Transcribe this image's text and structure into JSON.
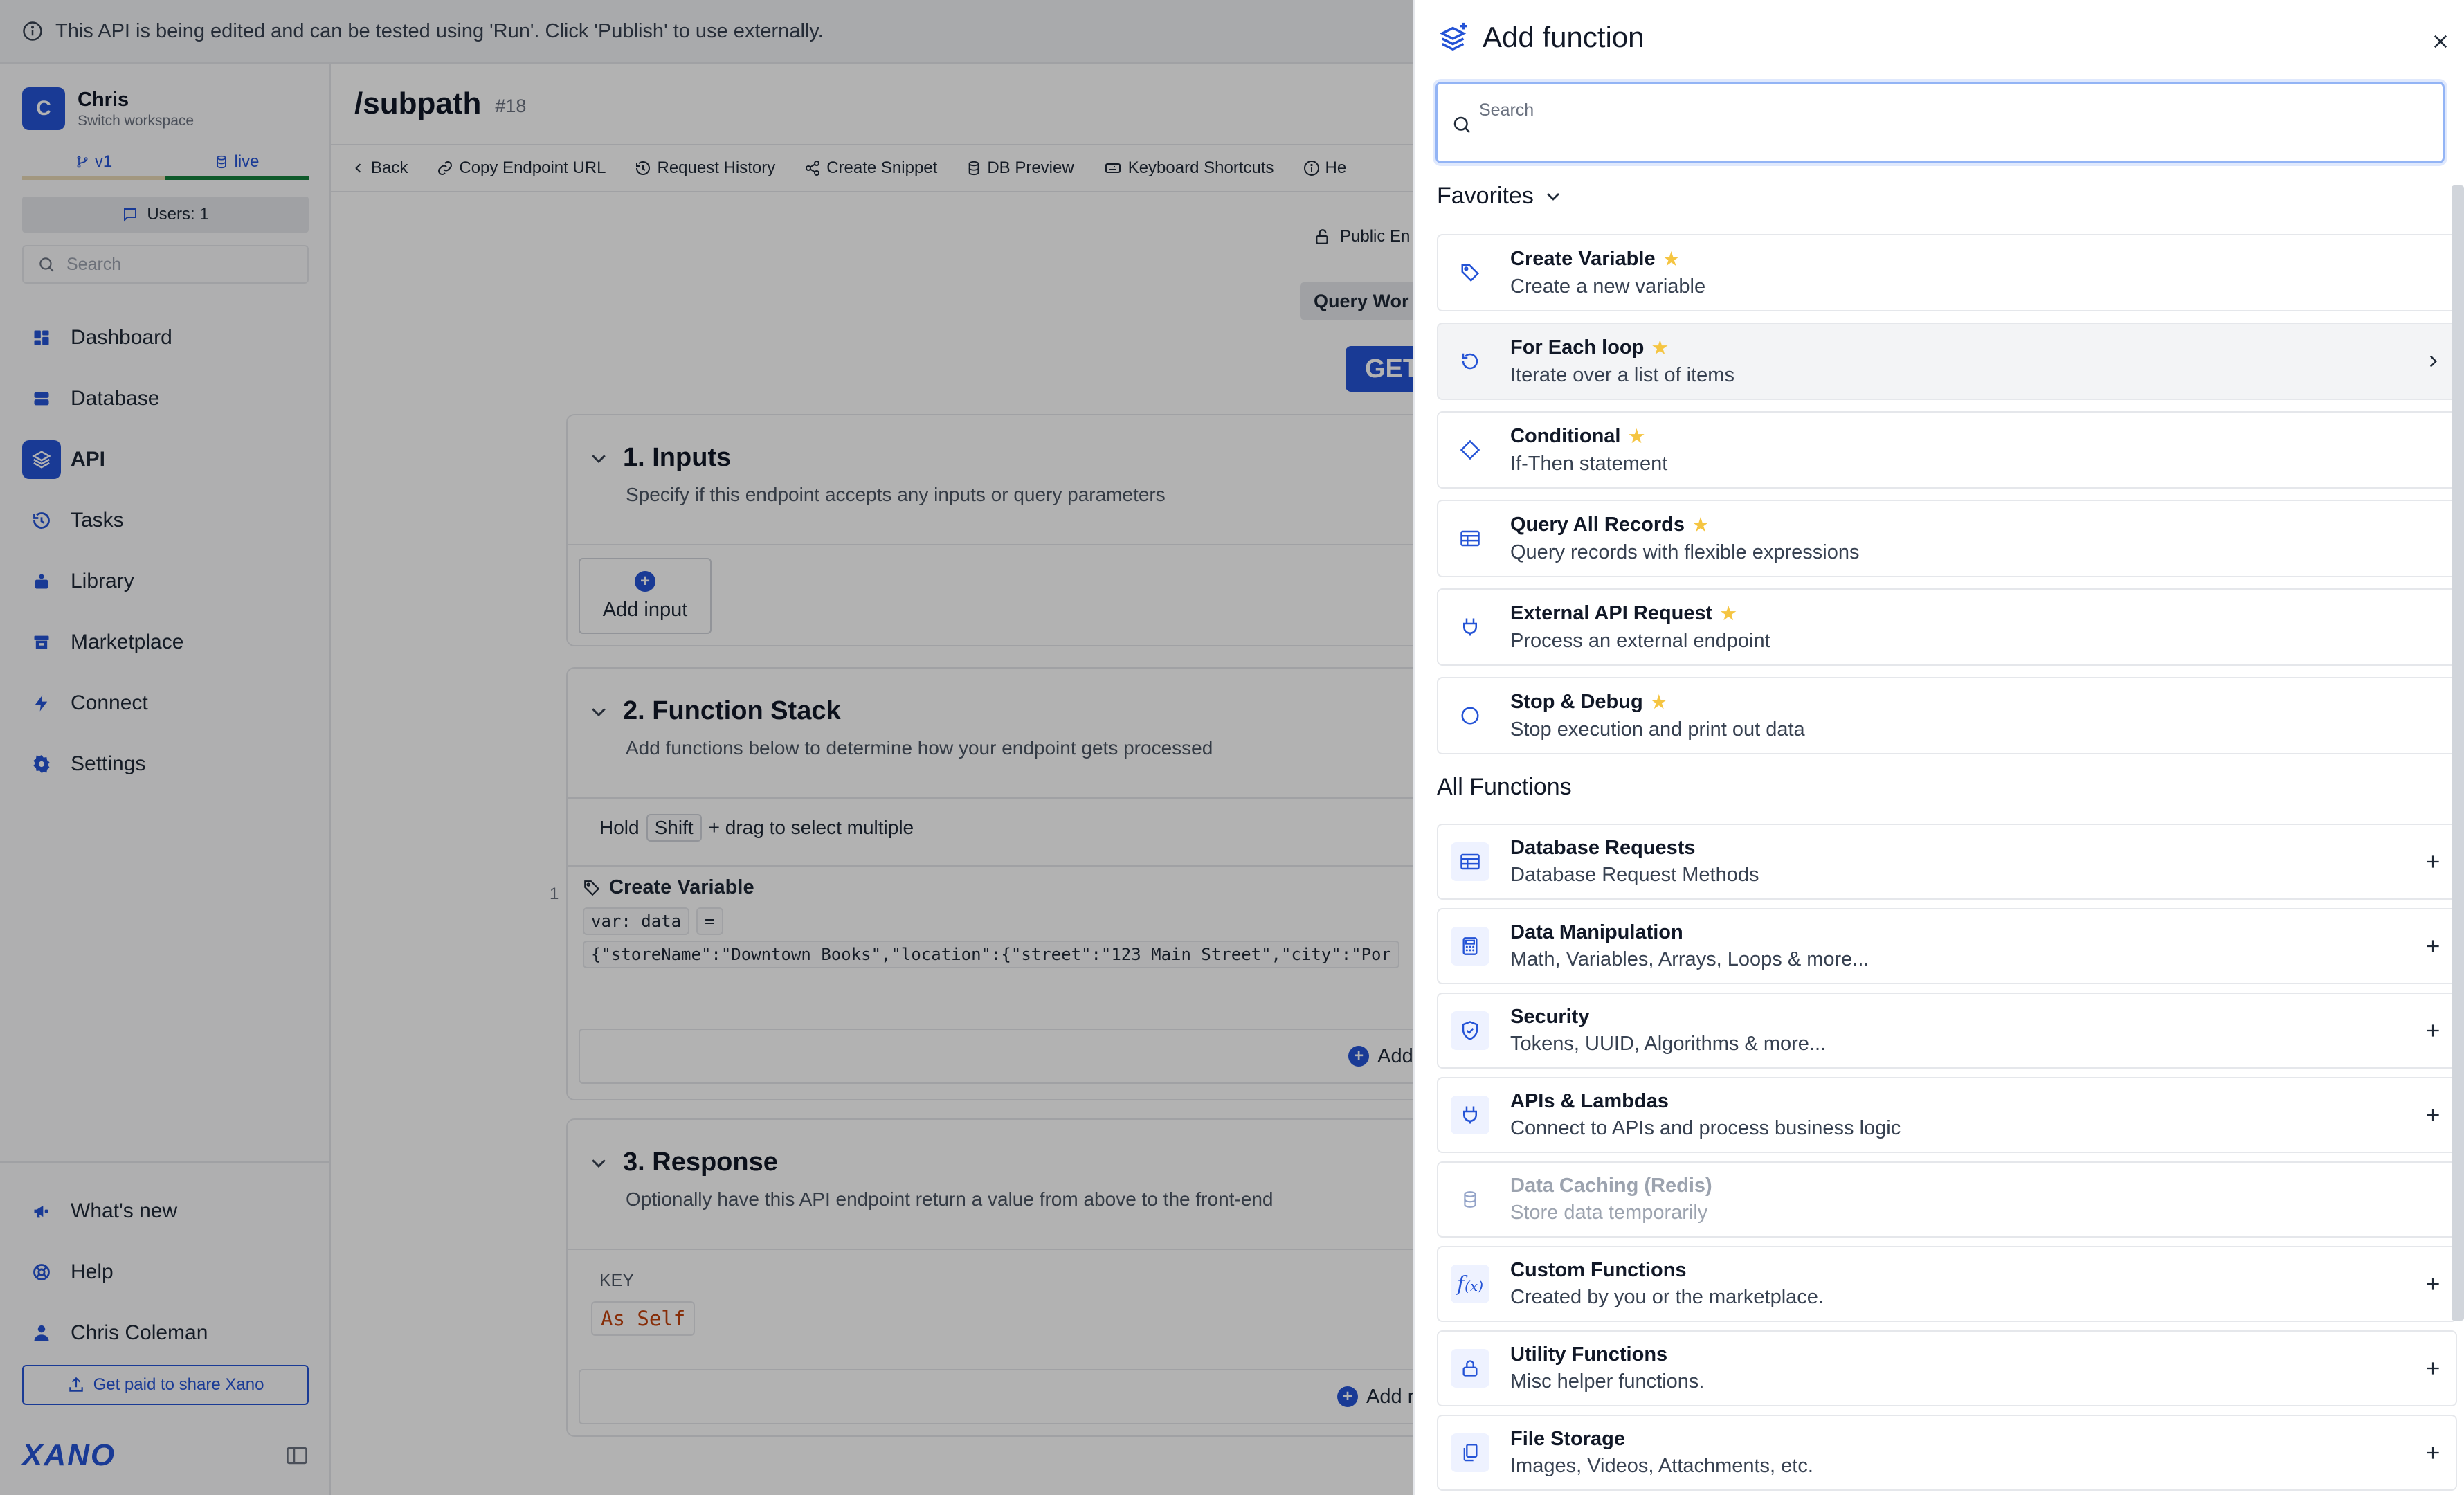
{
  "banner": {
    "text": "This API is being edited and can be tested using 'Run'. Click 'Publish' to use externally."
  },
  "sidebar": {
    "workspace": {
      "initial": "C",
      "name": "Chris",
      "sub": "Switch workspace"
    },
    "branches": [
      {
        "label": "v1"
      },
      {
        "label": "live"
      }
    ],
    "users": "Users: 1",
    "search_placeholder": "Search",
    "nav": [
      {
        "label": "Dashboard",
        "icon": "dashboard-icon"
      },
      {
        "label": "Database",
        "icon": "database-icon"
      },
      {
        "label": "API",
        "icon": "api-icon"
      },
      {
        "label": "Tasks",
        "icon": "tasks-icon"
      },
      {
        "label": "Library",
        "icon": "library-icon"
      },
      {
        "label": "Marketplace",
        "icon": "marketplace-icon"
      },
      {
        "label": "Connect",
        "icon": "bolt-icon"
      },
      {
        "label": "Settings",
        "icon": "gear-icon"
      }
    ],
    "bottom": [
      {
        "label": "What's new",
        "icon": "megaphone-icon"
      },
      {
        "label": "Help",
        "icon": "help-icon"
      },
      {
        "label": "Chris Coleman",
        "icon": "user-icon"
      }
    ],
    "paid_button": "Get paid to share Xano",
    "logo": "XANO"
  },
  "main": {
    "title": "/subpath",
    "id": "#18",
    "toolbar": [
      {
        "label": "Back",
        "icon": "chevron-left-icon"
      },
      {
        "label": "Copy Endpoint URL",
        "icon": "link-icon"
      },
      {
        "label": "Request History",
        "icon": "history-icon"
      },
      {
        "label": "Create Snippet",
        "icon": "share-icon"
      },
      {
        "label": "DB Preview",
        "icon": "database-icon"
      },
      {
        "label": "Keyboard Shortcuts",
        "icon": "keyboard-icon"
      },
      {
        "label": "He",
        "icon": "info-icon"
      }
    ],
    "public_endpoint": "Public En",
    "query_workflow": "Query Wor",
    "method": "GET",
    "inputs": {
      "title": "1. Inputs",
      "desc": "Specify if this endpoint accepts any inputs or query parameters",
      "add": "Add input"
    },
    "stack": {
      "title": "2. Function Stack",
      "desc": "Add functions below to determine how your endpoint gets processed",
      "hold": "Hold",
      "shift": "Shift",
      "hint": "+ drag to select multiple",
      "step_num": "1",
      "step_title": "Create Variable",
      "var_label": "var: data",
      "eq": "=",
      "value": "{\"storeName\":\"Downtown Books\",\"location\":{\"street\":\"123 Main Street\",\"city\":\"Por",
      "add": "Add fu"
    },
    "response": {
      "title": "3. Response",
      "desc": "Optionally have this API endpoint return a value from above to the front-end",
      "key": "KEY",
      "value": "As Self",
      "add": "Add res"
    }
  },
  "panel": {
    "title": "Add function",
    "search_placeholder": "Search",
    "favorites_title": "Favorites",
    "favorites": [
      {
        "name": "Create Variable",
        "desc": "Create a new variable",
        "icon": "tag-icon"
      },
      {
        "name": "For Each loop",
        "desc": "Iterate over a list of items",
        "icon": "loop-icon"
      },
      {
        "name": "Conditional",
        "desc": "If-Then statement",
        "icon": "diamond-icon"
      },
      {
        "name": "Query All Records",
        "desc": "Query records with flexible expressions",
        "icon": "table-icon"
      },
      {
        "name": "External API Request",
        "desc": "Process an external endpoint",
        "icon": "plug-icon"
      },
      {
        "name": "Stop & Debug",
        "desc": "Stop execution and print out data",
        "icon": "circle-icon"
      }
    ],
    "all_title": "All Functions",
    "all": [
      {
        "name": "Database Requests",
        "desc": "Database Request Methods",
        "icon": "table-icon"
      },
      {
        "name": "Data Manipulation",
        "desc": "Math, Variables, Arrays, Loops & more...",
        "icon": "calculator-icon"
      },
      {
        "name": "Security",
        "desc": "Tokens, UUID, Algorithms & more...",
        "icon": "shield-icon"
      },
      {
        "name": "APIs & Lambdas",
        "desc": "Connect to APIs and process business logic",
        "icon": "plug-icon"
      },
      {
        "name": "Data Caching (Redis)",
        "desc": "Store data temporarily",
        "icon": "database-icon"
      },
      {
        "name": "Custom Functions",
        "desc": "Created by you or the marketplace.",
        "icon": "function-icon"
      },
      {
        "name": "Utility Functions",
        "desc": "Misc helper functions.",
        "icon": "lock-icon"
      },
      {
        "name": "File Storage",
        "desc": "Images, Videos, Attachments, etc.",
        "icon": "files-icon"
      }
    ]
  },
  "colors": {
    "accent": "#2453d6",
    "star": "#f5c542",
    "live": "#15803d"
  }
}
